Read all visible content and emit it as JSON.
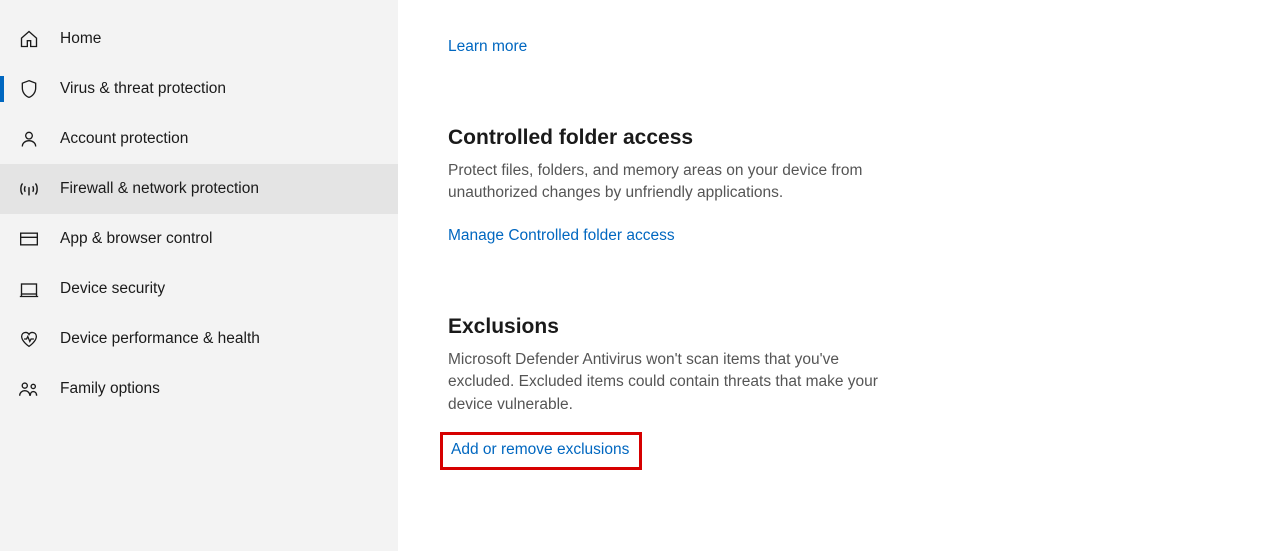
{
  "sidebar": {
    "items": [
      {
        "label": "Home"
      },
      {
        "label": "Virus & threat protection"
      },
      {
        "label": "Account protection"
      },
      {
        "label": "Firewall & network protection"
      },
      {
        "label": "App & browser control"
      },
      {
        "label": "Device security"
      },
      {
        "label": "Device performance & health"
      },
      {
        "label": "Family options"
      }
    ]
  },
  "content": {
    "learn_more": "Learn more",
    "controlled_folder": {
      "heading": "Controlled folder access",
      "body": "Protect files, folders, and memory areas on your device from unauthorized changes by unfriendly applications.",
      "link": "Manage Controlled folder access"
    },
    "exclusions": {
      "heading": "Exclusions",
      "body": "Microsoft Defender Antivirus won't scan items that you've excluded. Excluded items could contain threats that make your device vulnerable.",
      "link": "Add or remove exclusions"
    }
  }
}
